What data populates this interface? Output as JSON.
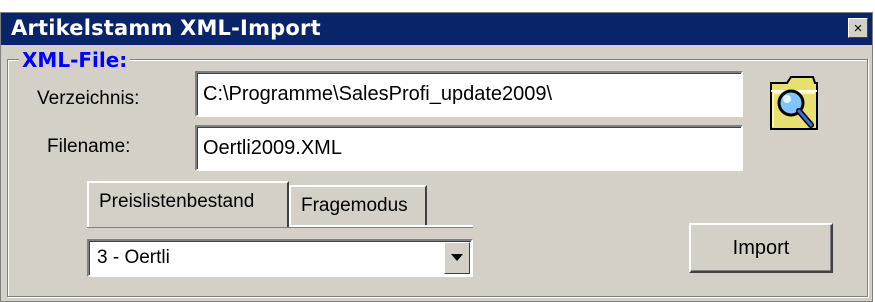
{
  "window": {
    "title": "Artikelstamm XML-Import",
    "close_glyph": "×"
  },
  "group": {
    "legend": "XML-File:"
  },
  "form": {
    "directory_label": "Verzeichnis:",
    "directory_value": "C:\\Programme\\SalesProfi_update2009\\",
    "filename_label": "Filename:",
    "filename_value": "Oertli2009.XML",
    "browse_icon": "folder-search-icon"
  },
  "tabs": [
    {
      "label": "Preislistenbestand",
      "active": true
    },
    {
      "label": "Fragemodus",
      "active": false
    }
  ],
  "combo": {
    "selected": "3 - Oertli"
  },
  "buttons": {
    "import_label": "Import"
  },
  "colors": {
    "titlebar": "#0a246a",
    "legend": "#0000ff",
    "face": "#d4d0c8"
  }
}
